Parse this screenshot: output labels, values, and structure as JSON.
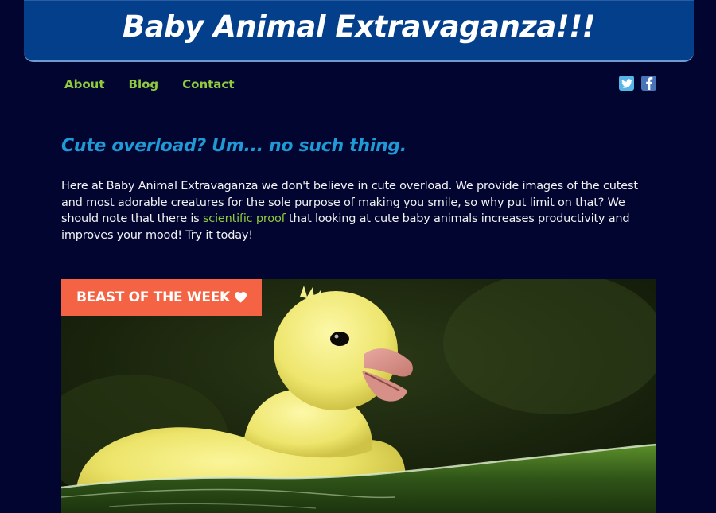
{
  "header": {
    "title": "Baby Animal Extravaganza!!!"
  },
  "nav": {
    "items": [
      {
        "label": "About"
      },
      {
        "label": "Blog"
      },
      {
        "label": "Contact"
      }
    ]
  },
  "social": {
    "icons": [
      "twitter-icon",
      "facebook-icon"
    ]
  },
  "intro": {
    "heading": "Cute overload? Um... no such thing.",
    "text_before_link": "Here at Baby Animal Extravaganza we don't believe in cute overload. We provide images of the cutest and most adorable creatures for the sole purpose of making you smile, so why put limit on that? We should note that there is ",
    "link_text": "scientific proof",
    "text_after_link": " that looking at cute baby animals increases productivity and improves your mood! Try it today!"
  },
  "feature": {
    "badge_label": "BEAST OF THE WEEK",
    "badge_icon": "heart-icon",
    "image_subject": "duckling"
  },
  "colors": {
    "background": "#020530",
    "header": "#043f8c",
    "nav_link": "#8fcb3c",
    "tagline": "#1f9ad6",
    "badge": "#f46444"
  }
}
